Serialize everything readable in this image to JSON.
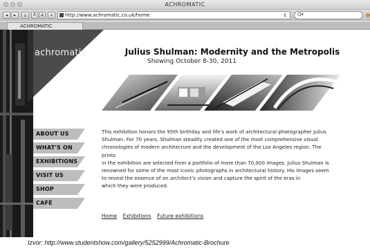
{
  "window": {
    "title": "ACHROMATIC"
  },
  "toolbar": {
    "back_icon": "back-arrow",
    "forward_icon": "forward-arrow",
    "small_text_label": "A",
    "large_text_label": "A",
    "add_label": "+",
    "url": "http://www.achromatic.co.uk/home",
    "reload_glyph": "¢",
    "search_glyph": "Q▾"
  },
  "tab": {
    "label": "ACHROMATIC"
  },
  "site": {
    "logo": "achromatic",
    "title": "Julius Shulman: Modernity and the Metropolis",
    "subtitle": "Showing October 8-30, 2011",
    "nav": [
      "ABOUT US",
      "WHAT'S ON",
      "EXHIBITIONS",
      "VISIT US",
      "SHOP",
      "CAFÉ"
    ],
    "body_lines": [
      "This exhibition honors the 95th birthday and life’s work of architectural photographer Julius",
      "Shulman. For 70 years, Shulman steadily created one of the most comprehensive visual",
      "chronologies of modern architecture and the development of the Los Angeles region. The prints",
      "in the exhibition are selected from a portfolio of more than 70,000 images. Julius Shulman is",
      "renowned for some of the most iconic photographs in architectural history. His images seem",
      "to reveal the essence of an architect’s vision and capture the spirit of the eras in",
      "which they were produced."
    ],
    "footer_links": [
      "Home",
      "Exhibitions",
      "Future exhibitions"
    ]
  },
  "caption": "Izvor: http://www.studentshow.com/gallery/5252999/Achromatic-Brochure"
}
